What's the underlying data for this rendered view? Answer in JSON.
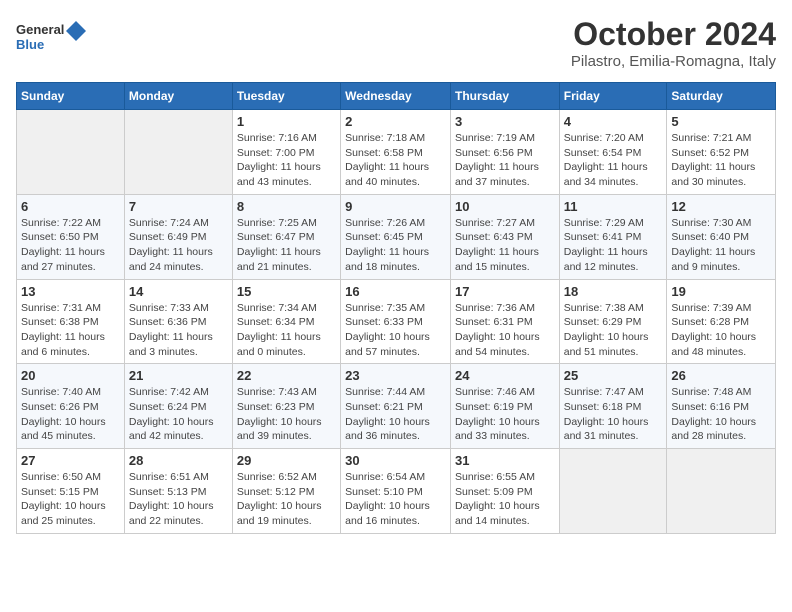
{
  "header": {
    "logo_general": "General",
    "logo_blue": "Blue",
    "title": "October 2024",
    "subtitle": "Pilastro, Emilia-Romagna, Italy"
  },
  "weekdays": [
    "Sunday",
    "Monday",
    "Tuesday",
    "Wednesday",
    "Thursday",
    "Friday",
    "Saturday"
  ],
  "weeks": [
    [
      {
        "day": "",
        "sunrise": "",
        "sunset": "",
        "daylight": ""
      },
      {
        "day": "",
        "sunrise": "",
        "sunset": "",
        "daylight": ""
      },
      {
        "day": "1",
        "sunrise": "Sunrise: 7:16 AM",
        "sunset": "Sunset: 7:00 PM",
        "daylight": "Daylight: 11 hours and 43 minutes."
      },
      {
        "day": "2",
        "sunrise": "Sunrise: 7:18 AM",
        "sunset": "Sunset: 6:58 PM",
        "daylight": "Daylight: 11 hours and 40 minutes."
      },
      {
        "day": "3",
        "sunrise": "Sunrise: 7:19 AM",
        "sunset": "Sunset: 6:56 PM",
        "daylight": "Daylight: 11 hours and 37 minutes."
      },
      {
        "day": "4",
        "sunrise": "Sunrise: 7:20 AM",
        "sunset": "Sunset: 6:54 PM",
        "daylight": "Daylight: 11 hours and 34 minutes."
      },
      {
        "day": "5",
        "sunrise": "Sunrise: 7:21 AM",
        "sunset": "Sunset: 6:52 PM",
        "daylight": "Daylight: 11 hours and 30 minutes."
      }
    ],
    [
      {
        "day": "6",
        "sunrise": "Sunrise: 7:22 AM",
        "sunset": "Sunset: 6:50 PM",
        "daylight": "Daylight: 11 hours and 27 minutes."
      },
      {
        "day": "7",
        "sunrise": "Sunrise: 7:24 AM",
        "sunset": "Sunset: 6:49 PM",
        "daylight": "Daylight: 11 hours and 24 minutes."
      },
      {
        "day": "8",
        "sunrise": "Sunrise: 7:25 AM",
        "sunset": "Sunset: 6:47 PM",
        "daylight": "Daylight: 11 hours and 21 minutes."
      },
      {
        "day": "9",
        "sunrise": "Sunrise: 7:26 AM",
        "sunset": "Sunset: 6:45 PM",
        "daylight": "Daylight: 11 hours and 18 minutes."
      },
      {
        "day": "10",
        "sunrise": "Sunrise: 7:27 AM",
        "sunset": "Sunset: 6:43 PM",
        "daylight": "Daylight: 11 hours and 15 minutes."
      },
      {
        "day": "11",
        "sunrise": "Sunrise: 7:29 AM",
        "sunset": "Sunset: 6:41 PM",
        "daylight": "Daylight: 11 hours and 12 minutes."
      },
      {
        "day": "12",
        "sunrise": "Sunrise: 7:30 AM",
        "sunset": "Sunset: 6:40 PM",
        "daylight": "Daylight: 11 hours and 9 minutes."
      }
    ],
    [
      {
        "day": "13",
        "sunrise": "Sunrise: 7:31 AM",
        "sunset": "Sunset: 6:38 PM",
        "daylight": "Daylight: 11 hours and 6 minutes."
      },
      {
        "day": "14",
        "sunrise": "Sunrise: 7:33 AM",
        "sunset": "Sunset: 6:36 PM",
        "daylight": "Daylight: 11 hours and 3 minutes."
      },
      {
        "day": "15",
        "sunrise": "Sunrise: 7:34 AM",
        "sunset": "Sunset: 6:34 PM",
        "daylight": "Daylight: 11 hours and 0 minutes."
      },
      {
        "day": "16",
        "sunrise": "Sunrise: 7:35 AM",
        "sunset": "Sunset: 6:33 PM",
        "daylight": "Daylight: 10 hours and 57 minutes."
      },
      {
        "day": "17",
        "sunrise": "Sunrise: 7:36 AM",
        "sunset": "Sunset: 6:31 PM",
        "daylight": "Daylight: 10 hours and 54 minutes."
      },
      {
        "day": "18",
        "sunrise": "Sunrise: 7:38 AM",
        "sunset": "Sunset: 6:29 PM",
        "daylight": "Daylight: 10 hours and 51 minutes."
      },
      {
        "day": "19",
        "sunrise": "Sunrise: 7:39 AM",
        "sunset": "Sunset: 6:28 PM",
        "daylight": "Daylight: 10 hours and 48 minutes."
      }
    ],
    [
      {
        "day": "20",
        "sunrise": "Sunrise: 7:40 AM",
        "sunset": "Sunset: 6:26 PM",
        "daylight": "Daylight: 10 hours and 45 minutes."
      },
      {
        "day": "21",
        "sunrise": "Sunrise: 7:42 AM",
        "sunset": "Sunset: 6:24 PM",
        "daylight": "Daylight: 10 hours and 42 minutes."
      },
      {
        "day": "22",
        "sunrise": "Sunrise: 7:43 AM",
        "sunset": "Sunset: 6:23 PM",
        "daylight": "Daylight: 10 hours and 39 minutes."
      },
      {
        "day": "23",
        "sunrise": "Sunrise: 7:44 AM",
        "sunset": "Sunset: 6:21 PM",
        "daylight": "Daylight: 10 hours and 36 minutes."
      },
      {
        "day": "24",
        "sunrise": "Sunrise: 7:46 AM",
        "sunset": "Sunset: 6:19 PM",
        "daylight": "Daylight: 10 hours and 33 minutes."
      },
      {
        "day": "25",
        "sunrise": "Sunrise: 7:47 AM",
        "sunset": "Sunset: 6:18 PM",
        "daylight": "Daylight: 10 hours and 31 minutes."
      },
      {
        "day": "26",
        "sunrise": "Sunrise: 7:48 AM",
        "sunset": "Sunset: 6:16 PM",
        "daylight": "Daylight: 10 hours and 28 minutes."
      }
    ],
    [
      {
        "day": "27",
        "sunrise": "Sunrise: 6:50 AM",
        "sunset": "Sunset: 5:15 PM",
        "daylight": "Daylight: 10 hours and 25 minutes."
      },
      {
        "day": "28",
        "sunrise": "Sunrise: 6:51 AM",
        "sunset": "Sunset: 5:13 PM",
        "daylight": "Daylight: 10 hours and 22 minutes."
      },
      {
        "day": "29",
        "sunrise": "Sunrise: 6:52 AM",
        "sunset": "Sunset: 5:12 PM",
        "daylight": "Daylight: 10 hours and 19 minutes."
      },
      {
        "day": "30",
        "sunrise": "Sunrise: 6:54 AM",
        "sunset": "Sunset: 5:10 PM",
        "daylight": "Daylight: 10 hours and 16 minutes."
      },
      {
        "day": "31",
        "sunrise": "Sunrise: 6:55 AM",
        "sunset": "Sunset: 5:09 PM",
        "daylight": "Daylight: 10 hours and 14 minutes."
      },
      {
        "day": "",
        "sunrise": "",
        "sunset": "",
        "daylight": ""
      },
      {
        "day": "",
        "sunrise": "",
        "sunset": "",
        "daylight": ""
      }
    ]
  ]
}
